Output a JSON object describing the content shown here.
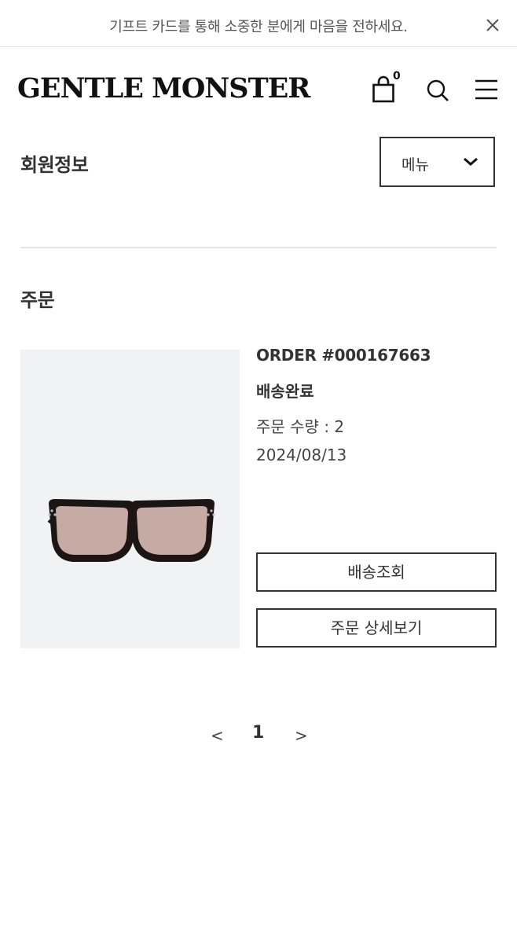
{
  "banner": {
    "text": "기프트 카드를 통해 소중한 분에게 마음을 전하세요.",
    "close_icon": "close-icon"
  },
  "header": {
    "logo": "GENTLE MONSTER",
    "cart_icon": "shopping-bag-icon",
    "cart_count": "0",
    "search_icon": "search-icon",
    "menu_icon": "hamburger-menu-icon"
  },
  "account": {
    "title": "회원정보",
    "menu_dropdown_label": "메뉴",
    "menu_dropdown_icon": "chevron-down-icon"
  },
  "orders": {
    "section_title": "주문",
    "items": [
      {
        "order_number": "ORDER #000167663",
        "status": "배송완료",
        "quantity": "주문 수량 : 2",
        "date": "2024/08/13",
        "track_button": "배송조회",
        "detail_button": "주문 상세보기"
      }
    ]
  },
  "pagination": {
    "prev": "<",
    "current": "1",
    "next": ">"
  },
  "colors": {
    "text": "#333333",
    "border": "#333333",
    "image_background": "#f0f2f4",
    "divider": "#e3e3e3",
    "lens": "#c6aaa4",
    "frame": "#1c1513"
  }
}
